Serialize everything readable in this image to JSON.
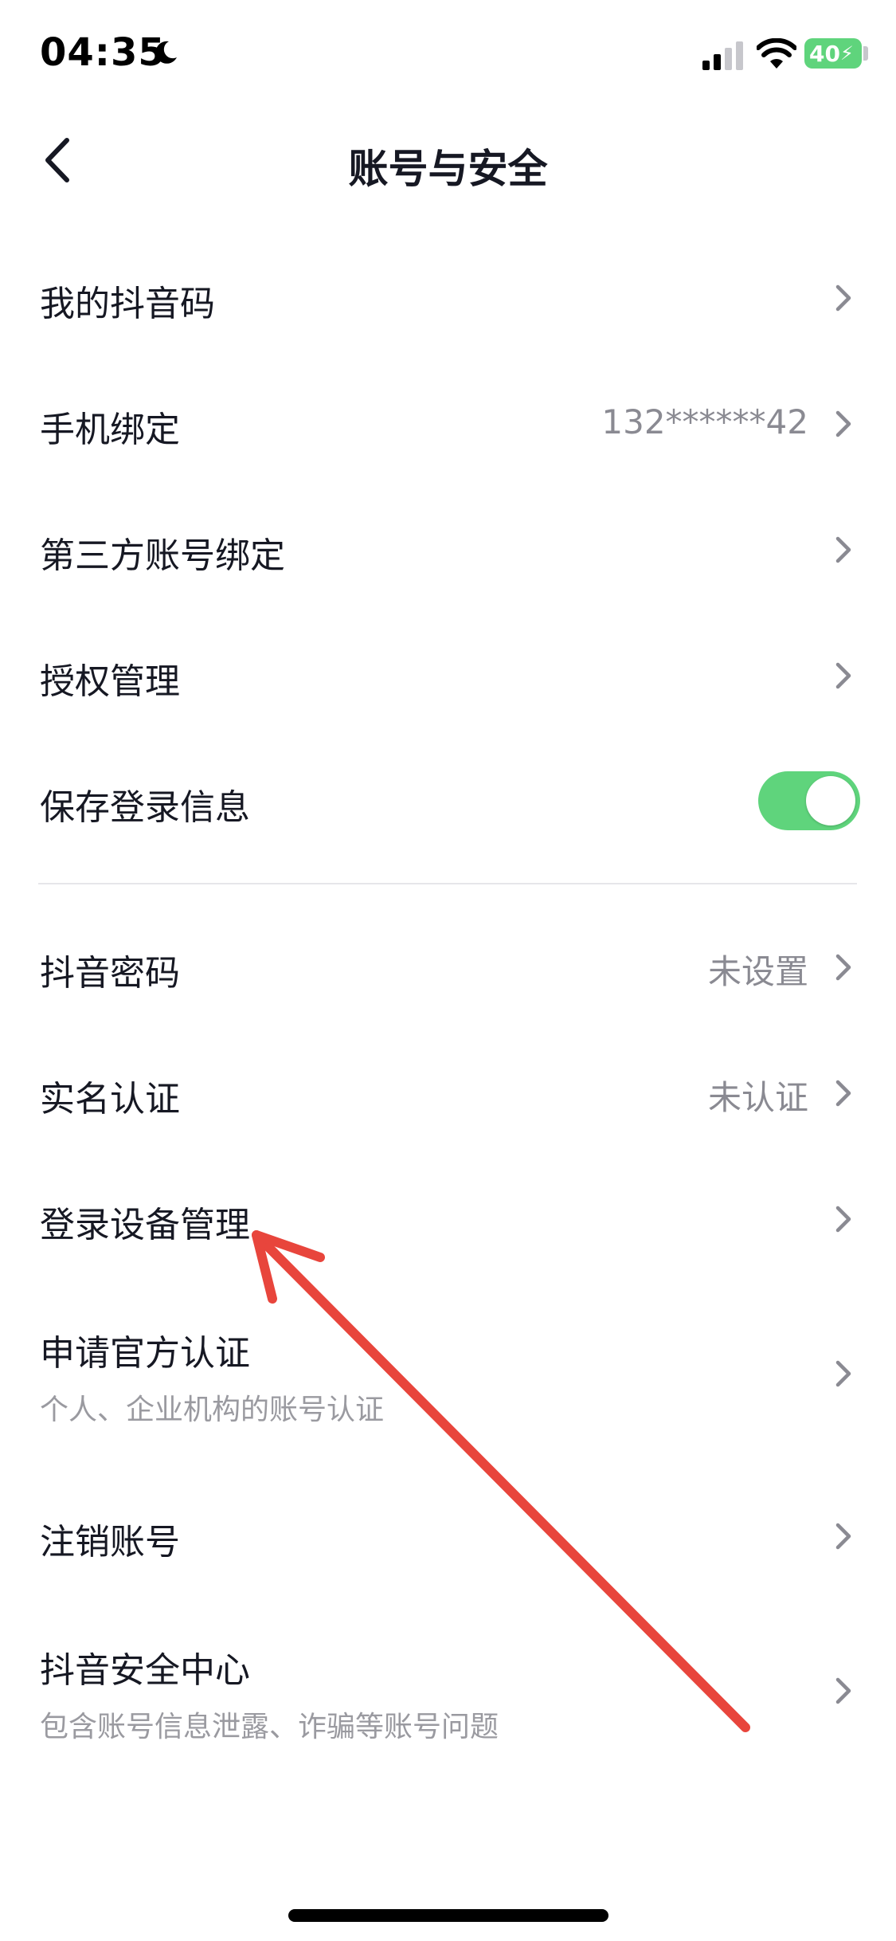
{
  "status_bar": {
    "time": "04:35",
    "battery": "40",
    "icons": [
      "moon-icon",
      "signal-icon",
      "wifi-icon",
      "battery-icon"
    ]
  },
  "nav": {
    "title": "账号与安全",
    "back_icon": "chevron-left-icon"
  },
  "rows": [
    {
      "label": "我的抖音码",
      "value": "",
      "sub": ""
    },
    {
      "label": "手机绑定",
      "value": "132******42",
      "sub": ""
    },
    {
      "label": "第三方账号绑定",
      "value": "",
      "sub": ""
    },
    {
      "label": "授权管理",
      "value": "",
      "sub": ""
    },
    {
      "label": "保存登录信息",
      "toggle_on": true
    },
    {
      "label": "抖音密码",
      "value": "未设置",
      "sub": ""
    },
    {
      "label": "实名认证",
      "value": "未认证",
      "sub": ""
    },
    {
      "label": "登录设备管理",
      "value": "",
      "sub": ""
    },
    {
      "label": "申请官方认证",
      "value": "",
      "sub": "个人、企业机构的账号认证"
    },
    {
      "label": "注销账号",
      "value": "",
      "sub": ""
    },
    {
      "label": "抖音安全中心",
      "value": "",
      "sub": "包含账号信息泄露、诈骗等账号问题"
    }
  ],
  "colors": {
    "toggle_on": "#5fd47c",
    "annotation_arrow": "#e8453c",
    "secondary_text": "#8a8a92"
  }
}
